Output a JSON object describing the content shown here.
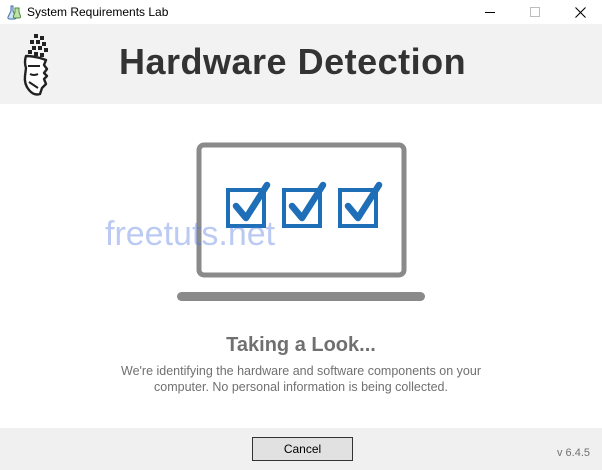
{
  "window": {
    "title": "System Requirements Lab",
    "controls": [
      "minimize",
      "maximize",
      "close"
    ]
  },
  "header": {
    "title": "Hardware Detection",
    "logo_icon": "srl-head-logo"
  },
  "illustration": {
    "icon": "laptop-checklist-icon",
    "checkbox_count": 3,
    "colors": {
      "laptop": "#8a8a8a",
      "check": "#1e6fb8"
    }
  },
  "watermark": "freetuts.net",
  "status": {
    "title": "Taking a Look...",
    "description": "We're identifying the hardware and software components on your computer. No personal information is being collected."
  },
  "footer": {
    "cancel_label": "Cancel",
    "version": "v 6.4.5"
  }
}
